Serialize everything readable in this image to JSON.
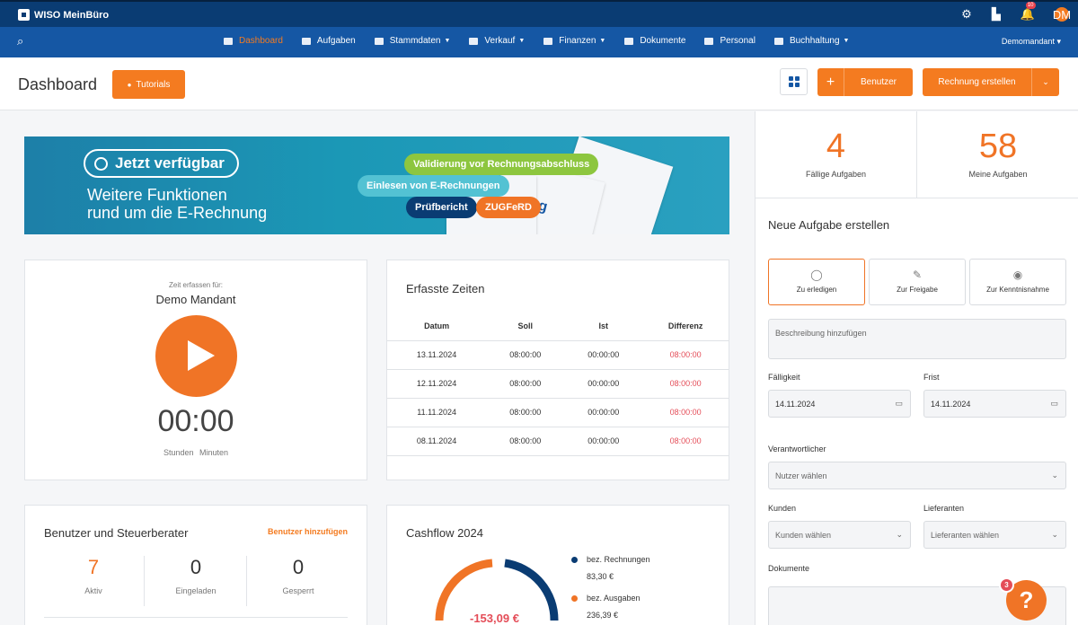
{
  "app": {
    "name": "WISO MeinBüro",
    "notification_count": "10",
    "avatar_initials": "DM"
  },
  "nav": {
    "items": [
      {
        "label": "Dashboard",
        "active": true,
        "caret": false
      },
      {
        "label": "Aufgaben",
        "caret": false
      },
      {
        "label": "Stammdaten",
        "caret": true
      },
      {
        "label": "Verkauf",
        "caret": true
      },
      {
        "label": "Finanzen",
        "caret": true
      },
      {
        "label": "Dokumente",
        "caret": false
      },
      {
        "label": "Personal",
        "caret": false
      },
      {
        "label": "Buchhaltung",
        "caret": true
      }
    ],
    "mandant": "Demomandant"
  },
  "header": {
    "title": "Dashboard",
    "tutorials_label": "Tutorials",
    "benutzer_label": "Benutzer",
    "rechnung_label": "Rechnung erstellen"
  },
  "banner": {
    "badge": "Jetzt verfügbar",
    "line1": "Weitere Funktionen",
    "line2": "rund um die E-Rechnung",
    "tags": [
      "Validierung vor Rechnungsabschluss",
      "Einlesen von E-Rechnungen",
      "Prüfbericht",
      "ZUGFeRD"
    ],
    "paper_text": "nung"
  },
  "zeit": {
    "label": "Zeit erfassen für:",
    "mandant": "Demo Mandant",
    "clock": "00:00",
    "units": "Stunden Minuten"
  },
  "zeiten": {
    "title": "Erfasste Zeiten",
    "columns": [
      "Datum",
      "Soll",
      "Ist",
      "Differenz"
    ],
    "rows": [
      [
        "13.11.2024",
        "08:00:00",
        "00:00:00",
        "08:00:00"
      ],
      [
        "12.11.2024",
        "08:00:00",
        "00:00:00",
        "08:00:00"
      ],
      [
        "11.11.2024",
        "08:00:00",
        "00:00:00",
        "08:00:00"
      ],
      [
        "08.11.2024",
        "08:00:00",
        "00:00:00",
        "08:00:00"
      ]
    ]
  },
  "benutzer_card": {
    "title": "Benutzer und Steuerberater",
    "add_link": "Benutzer hinzufügen",
    "stats": [
      {
        "value": "7",
        "label": "Aktiv"
      },
      {
        "value": "0",
        "label": "Eingeladen"
      },
      {
        "value": "0",
        "label": "Gesperrt"
      }
    ]
  },
  "cashflow": {
    "title": "Cashflow 2024",
    "center_value": "-153,09 €",
    "legend": [
      {
        "label": "bez. Rechnungen",
        "value": "83,30 €",
        "color": "#0a3c73"
      },
      {
        "label": "bez. Ausgaben",
        "value": "236,39 €",
        "color": "#f07426"
      }
    ]
  },
  "side": {
    "kpis": [
      {
        "value": "4",
        "label": "Fällige Aufgaben"
      },
      {
        "value": "58",
        "label": "Meine Aufgaben"
      }
    ],
    "new_task_title": "Neue Aufgabe erstellen",
    "types": [
      "Zu erledigen",
      "Zur Freigabe",
      "Zur Kenntnisnahme"
    ],
    "description_placeholder": "Beschreibung hinzufügen",
    "faelligkeit_label": "Fälligkeit",
    "faelligkeit_value": "14.11.2024",
    "frist_label": "Frist",
    "frist_value": "14.11.2024",
    "verantwortlicher_label": "Verantwortlicher",
    "verantwortlicher_placeholder": "Nutzer wählen",
    "kunden_label": "Kunden",
    "kunden_placeholder": "Kunden wählen",
    "lieferanten_label": "Lieferanten",
    "lieferanten_placeholder": "Lieferanten wählen",
    "dokumente_label": "Dokumente"
  },
  "help": {
    "badge": "3",
    "symbol": "?"
  }
}
